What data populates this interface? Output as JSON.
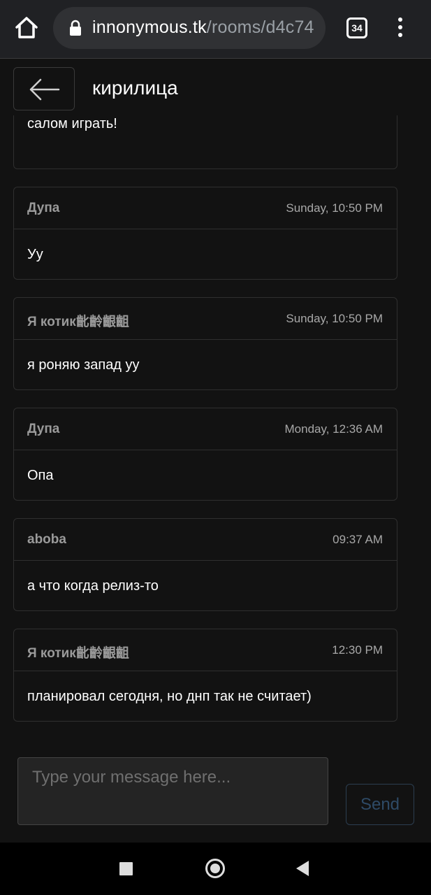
{
  "browser": {
    "url_domain": "innonymous.tk",
    "url_path": "/rooms/d4c74",
    "tab_count": "34"
  },
  "header": {
    "room_title": "кирилица"
  },
  "first_message_tail": "зачем я фурри, не слышит, никто не говорю💬 и салом играть!",
  "messages": [
    {
      "author": "Дупа",
      "time": "Sunday, 10:50 PM",
      "text": "Уу"
    },
    {
      "author": "Я котик齔齡齦齟",
      "time": "Sunday, 10:50 PM",
      "text": "я роняю запад уу"
    },
    {
      "author": "Дупа",
      "time": "Monday, 12:36 AM",
      "text": "Опа"
    },
    {
      "author": "aboba",
      "time": "09:37 AM",
      "text": "а что когда релиз-то"
    },
    {
      "author": "Я котик齔齡齦齟",
      "time": "12:30 PM",
      "text": "планировал сегодня, но днп так не считает)"
    }
  ],
  "compose": {
    "placeholder": "Type your message here...",
    "value": "",
    "send_label": "Send"
  }
}
